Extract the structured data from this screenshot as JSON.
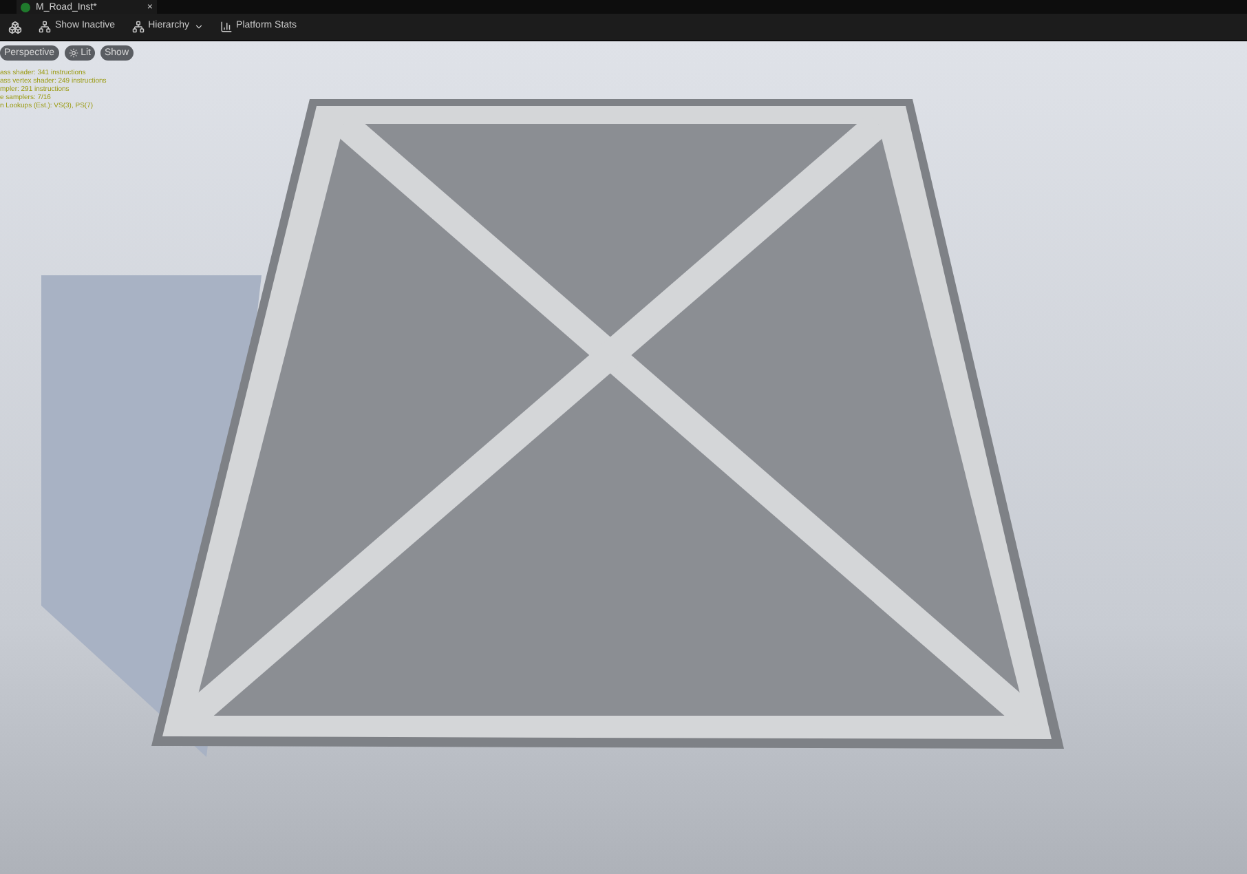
{
  "tab": {
    "title": "M_Road_Inst*",
    "close": "×"
  },
  "toolbar": [
    {
      "kind": "icon"
    },
    {
      "kind": "labeled",
      "label": "Show Inactive"
    },
    {
      "kind": "dropdown",
      "label": "Hierarchy"
    },
    {
      "kind": "labeled",
      "label": "Platform Stats"
    }
  ],
  "viewport_buttons": [
    {
      "label": "Perspective",
      "kind": "text"
    },
    {
      "label": "Lit",
      "kind": "icon"
    },
    {
      "label": "Show",
      "kind": "text"
    }
  ],
  "stats": [
    "ass shader: 341 instructions",
    "ass vertex shader: 249 instructions",
    "mpler: 291 instructions",
    "e samplers: 7/16",
    "n Lookups (Est.): VS(3), PS(7)"
  ]
}
